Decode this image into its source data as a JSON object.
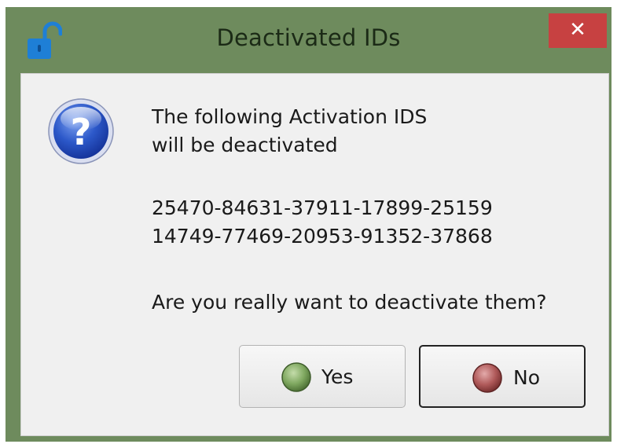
{
  "window": {
    "title": "Deactivated IDs",
    "close_glyph": "✕",
    "app_icon": "unlocked-padlock-icon",
    "frame_color": "#6e8b5d",
    "close_color": "#c74141"
  },
  "dialog": {
    "icon": "question-icon",
    "message_line1": "The following Activation IDS",
    "message_line2": "will be deactivated",
    "ids": [
      "25470-84631-37911-17899-25159",
      "14749-77469-20953-91352-37868"
    ],
    "prompt": "Are you really want to deactivate them?"
  },
  "buttons": {
    "yes": {
      "label": "Yes",
      "icon": "green-circle-icon",
      "color": "#7fa860"
    },
    "no": {
      "label": "No",
      "icon": "red-circle-icon",
      "color": "#b05a5a"
    }
  }
}
